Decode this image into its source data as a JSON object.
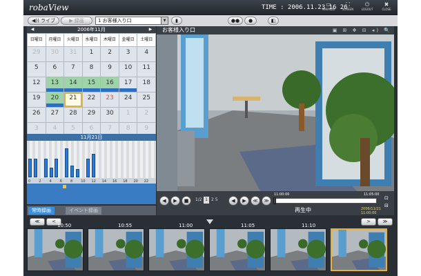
{
  "app": {
    "logo": "robaView",
    "time": "TIME : 2006.11.23 16 26",
    "window_buttons": [
      {
        "name": "minimize-button",
        "icon": "minimize-icon",
        "glyph": "▭",
        "label": "MINIMIZE"
      },
      {
        "name": "screen-button",
        "icon": "screen-icon",
        "glyph": "⛶",
        "label": "SCREEN"
      },
      {
        "name": "logout-button",
        "icon": "power-icon",
        "glyph": "⏻",
        "label": "LOGOUT"
      },
      {
        "name": "close-button",
        "icon": "close-icon",
        "glyph": "✖",
        "label": "CLOSE"
      }
    ]
  },
  "toolbar": {
    "live_label": "◀)) ライブ",
    "record_label": "▶ 録画",
    "camera_select_value": "1  お客様入り口",
    "camera_glyph": "▮",
    "users_glyph": "●●",
    "user_glyph": "●",
    "panel_glyph": "◧"
  },
  "calendar": {
    "month": "2006年11月",
    "prev": "◀",
    "next": "▶",
    "weekdays": [
      "日曜日",
      "月曜日",
      "火曜日",
      "水曜日",
      "木曜日",
      "金曜日",
      "土曜日"
    ],
    "days": [
      "29",
      "30",
      "31",
      "1",
      "2",
      "3",
      "4",
      "5",
      "6",
      "7",
      "8",
      "9",
      "10",
      "11",
      "12",
      "13",
      "14",
      "15",
      "16",
      "17",
      "18",
      "19",
      "20",
      "21",
      "22",
      "23",
      "24",
      "25",
      "26",
      "27",
      "28",
      "29",
      "30",
      "1",
      "2",
      "3",
      "4",
      "5",
      "6",
      "7",
      "8",
      "9"
    ]
  },
  "day_view": {
    "date_label": "11月21日",
    "hour_labels": [
      "0",
      "2",
      "4",
      "6",
      "8",
      "10",
      "12",
      "14",
      "16",
      "18",
      "20",
      "22"
    ],
    "hourly_activity": [
      0.62,
      0.62,
      0,
      0.62,
      0.32,
      0.62,
      0,
      0.95,
      0.38,
      0.28,
      0,
      0.62,
      0.78,
      0,
      0,
      0,
      0,
      0,
      0,
      0,
      0,
      0,
      0,
      0
    ]
  },
  "record_tabs": {
    "regular": "常時録画",
    "event": "イベント録画"
  },
  "viewer": {
    "camera_title": "お客様入り口",
    "tool_icons": "▣ ⊞ ✥ ⊟ ◂) 🔍"
  },
  "playback": {
    "prev_label": "◀",
    "next_label": "▶",
    "stop_label": "■",
    "page_info": "1/2",
    "page_current": "1",
    "page_others": "2   5",
    "rewind_label": "◀",
    "forward_label": "▶",
    "fast_rewind_label": "≪",
    "fast_forward_label": "≫",
    "start_time": "11:00:00",
    "end_time": "11:05:00",
    "status": "再生中",
    "timestamp": "2006/11/21 11:00:00",
    "progress": 0.0,
    "side_glyph_top": "⊡",
    "side_glyph_bottom": "⊟"
  },
  "thumbnail_strip": {
    "prev_label": "≪",
    "prev_single_label": "<",
    "next_single_label": ">",
    "next_label": "≫",
    "times": [
      "10:50",
      "10:55",
      "11:00",
      "11:05",
      "11:10"
    ],
    "selected_index": 5
  }
}
